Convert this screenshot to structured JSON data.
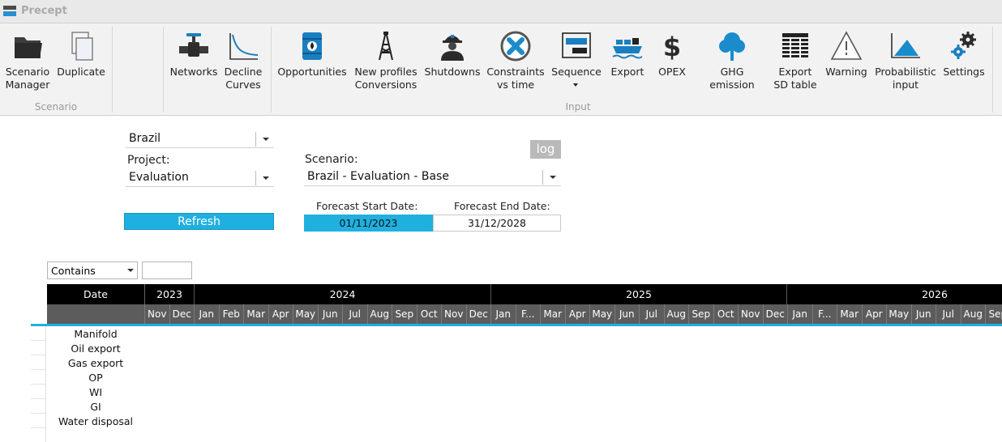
{
  "app": {
    "title": "Precept"
  },
  "ribbon": {
    "scenario_group": {
      "label": "Scenario",
      "buttons": [
        {
          "label": "Scenario\nManager",
          "icon": "folder-icon"
        },
        {
          "label": "Duplicate",
          "icon": "copy-documents-icon"
        }
      ]
    },
    "input_group": {
      "label": "Input",
      "buttons": [
        {
          "label": "Networks",
          "icon": "pipe-valve-icon"
        },
        {
          "label": "Decline\nCurves",
          "icon": "decline-curve-icon"
        },
        {
          "label": "Opportunities",
          "icon": "oil-barrel-icon"
        },
        {
          "label": "New profiles\nConversions",
          "icon": "oil-derrick-icon"
        },
        {
          "label": "Shutdowns",
          "icon": "worker-hardhat-icon"
        },
        {
          "label": "Constraints\nvs time",
          "icon": "x-circle-icon"
        },
        {
          "label": "Sequence",
          "icon": "sequence-bars-icon"
        },
        {
          "label": "Export",
          "icon": "tanker-ship-icon"
        },
        {
          "label": "OPEX",
          "icon": "dollar-icon"
        },
        {
          "label": "GHG emission",
          "icon": "tree-icon"
        },
        {
          "label": "Export\nSD table",
          "icon": "table-lines-icon"
        },
        {
          "label": "Warning",
          "icon": "warning-triangle-icon"
        },
        {
          "label": "Probabilistic\ninput",
          "icon": "distribution-chart-icon"
        },
        {
          "label": "Settings",
          "icon": "gears-icon"
        }
      ]
    }
  },
  "form": {
    "country": "Brazil",
    "project_label": "Project:",
    "project": "Evaluation",
    "scenario_label": "Scenario:",
    "scenario": "Brazil - Evaluation - Base",
    "log_label": "log",
    "refresh_label": "Refresh",
    "forecast_start_label": "Forecast Start Date:",
    "forecast_start": "01/11/2023",
    "forecast_end_label": "Forecast End Date:",
    "forecast_end": "31/12/2028"
  },
  "filter": {
    "mode": "Contains",
    "value": ""
  },
  "grid": {
    "date_header": "Date",
    "years": [
      "2023",
      "2024",
      "2025",
      "2026"
    ],
    "months": [
      "Nov",
      "Dec",
      "Jan",
      "Feb",
      "Mar",
      "Apr",
      "May",
      "Jun",
      "Jul",
      "Aug",
      "Sep",
      "Oct",
      "Nov",
      "Dec",
      "Jan",
      "F...",
      "Mar",
      "Apr",
      "May",
      "Jun",
      "Jul",
      "Aug",
      "Sep",
      "Oct",
      "Nov",
      "Dec",
      "Jan",
      "F...",
      "Mar",
      "Apr",
      "May",
      "Jun",
      "Jul",
      "Aug",
      "Sep"
    ],
    "rows": [
      "Manifold",
      "Oil export",
      "Gas export",
      "OP",
      "WI",
      "GI",
      "Water disposal"
    ]
  },
  "colors": {
    "accent": "#1fb0e0",
    "header_black": "#000000",
    "header_gray": "#5c5c5c"
  }
}
